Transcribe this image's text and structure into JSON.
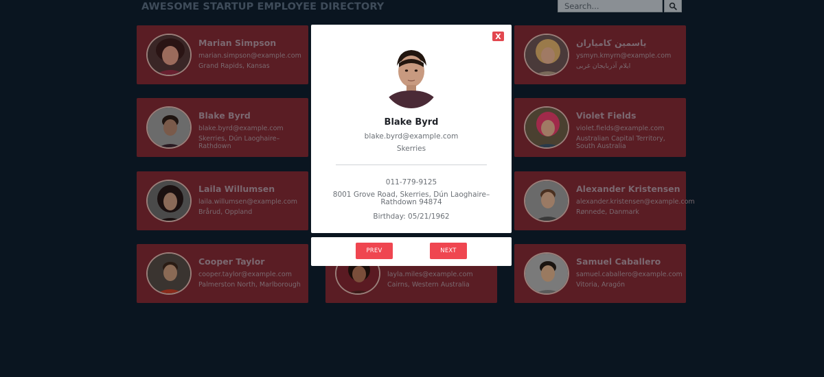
{
  "header": {
    "title": "AWESOME STARTUP EMPLOYEE DIRECTORY",
    "search_placeholder": "Search..."
  },
  "icons": {
    "search": "magnifier",
    "close": "close-x"
  },
  "colors": {
    "background": "#0a1520",
    "card": "#5a1d24",
    "accent": "#ef4650",
    "modal": "#ffffff"
  },
  "employees": [
    {
      "name": "Marian Simpson",
      "email": "marian.simpson@example.com",
      "location": "Grand Rapids, Kansas"
    },
    {
      "name": "Blake Byrd",
      "email": "blake.byrd@example.com",
      "location": "Skerries, Dún Laoghaire–Rathdown"
    },
    {
      "name": "Laila Willumsen",
      "email": "laila.willumsen@example.com",
      "location": "Brårud, Oppland"
    },
    {
      "name": "Cooper Taylor",
      "email": "cooper.taylor@example.com",
      "location": "Palmerston North, Marlborough"
    },
    {
      "name": "",
      "email": "layla.miles@example.com",
      "location": "Cairns, Western Australia"
    },
    {
      "name": "یاسمین کامیاران",
      "email": "ysmyn.kmyrn@example.com",
      "location": "ایلام آذربایجان غربی"
    },
    {
      "name": "Violet Fields",
      "email": "violet.fields@example.com",
      "location": "Australian Capital Territory, South Australia"
    },
    {
      "name": "Alexander Kristensen",
      "email": "alexander.kristensen@example.com",
      "location": "Rønnede, Danmark"
    },
    {
      "name": "Samuel Caballero",
      "email": "samuel.caballero@example.com",
      "location": "Vitoria, Aragón"
    }
  ],
  "modal": {
    "close_label": "X",
    "name": "Blake Byrd",
    "email": "blake.byrd@example.com",
    "city": "Skerries",
    "phone": "011-779-9125",
    "address": "8001 Grove Road, Skerries, Dún Laoghaire–Rathdown 94874",
    "birthday": "Birthday: 05/21/1962",
    "prev_label": "PREV",
    "next_label": "NEXT"
  }
}
